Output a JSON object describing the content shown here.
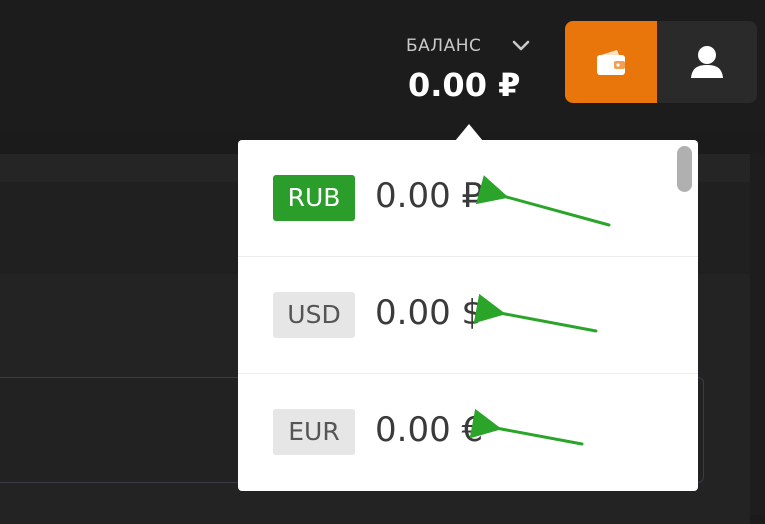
{
  "header": {
    "balance_label": "БАЛАНС",
    "balance_amount": "0.00 ₽",
    "wallet_icon": "wallet-icon",
    "user_icon": "user-icon",
    "accent_color": "#e8760a"
  },
  "dropdown": {
    "items": [
      {
        "code": "RUB",
        "amount": "0.00 ₽",
        "active": true
      },
      {
        "code": "USD",
        "amount": "0.00 $",
        "active": false
      },
      {
        "code": "EUR",
        "amount": "0.00 €",
        "active": false
      }
    ],
    "active_color": "#2a9d2a"
  },
  "annotations": {
    "arrow_color": "#2aa52a"
  }
}
